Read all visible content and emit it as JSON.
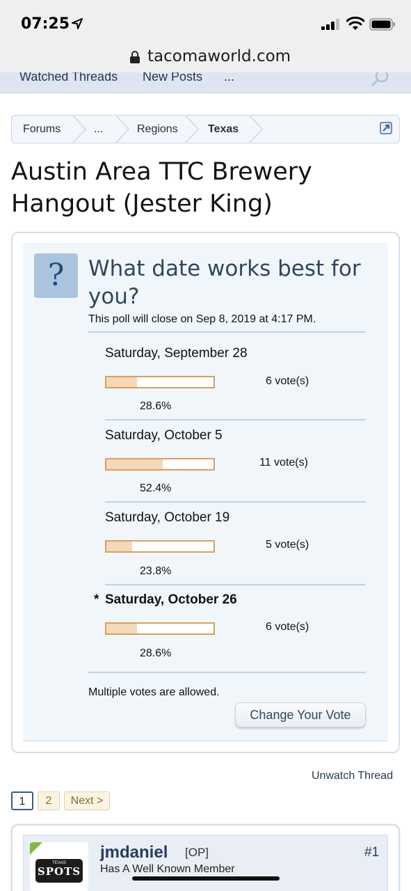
{
  "status_bar": {
    "time": "07:25"
  },
  "browser": {
    "url": "tacomaworld.com"
  },
  "nav": {
    "items": [
      "Watched Threads",
      "New Posts",
      "..."
    ]
  },
  "breadcrumb": {
    "items": [
      "Forums",
      "...",
      "Regions",
      "Texas"
    ]
  },
  "thread": {
    "title": "Austin Area TTC Brewery Hangout (Jester King)"
  },
  "poll": {
    "question": "What date works best for you?",
    "close_text": "This poll will close on Sep 8, 2019 at 4:17 PM.",
    "options": [
      {
        "label": "Saturday, September 28",
        "votes": "6 vote(s)",
        "percent": "28.6%",
        "fraction": 0.286,
        "user_voted": false
      },
      {
        "label": "Saturday, October 5",
        "votes": "11 vote(s)",
        "percent": "52.4%",
        "fraction": 0.524,
        "user_voted": false
      },
      {
        "label": "Saturday, October 19",
        "votes": "5 vote(s)",
        "percent": "23.8%",
        "fraction": 0.238,
        "user_voted": false
      },
      {
        "label": "Saturday, October 26",
        "votes": "6 vote(s)",
        "percent": "28.6%",
        "fraction": 0.286,
        "user_voted": true,
        "marker": "*"
      }
    ],
    "multiple_note": "Multiple votes are allowed.",
    "change_vote_label": "Change Your Vote"
  },
  "unwatch_label": "Unwatch Thread",
  "pagination": {
    "current": "1",
    "pages": [
      "2"
    ],
    "next": "Next >"
  },
  "post": {
    "username": "jmdaniel",
    "op_tag": "[OP]",
    "user_title": "Has A Well Known Member",
    "number": "#1",
    "avatar_text": {
      "top": "TEXAS",
      "main": "SPOTS"
    }
  },
  "colors": {
    "bar_border": "#d9a05c",
    "bar_fill": "#f4d8ba",
    "poll_bg": "#f1f6fa",
    "link": "#26384c",
    "online": "#7dbb3c"
  },
  "icons": [
    "location-arrow-icon",
    "signal-icon",
    "wifi-icon",
    "battery-icon",
    "lock-icon",
    "search-icon",
    "popout-icon",
    "question-icon"
  ]
}
